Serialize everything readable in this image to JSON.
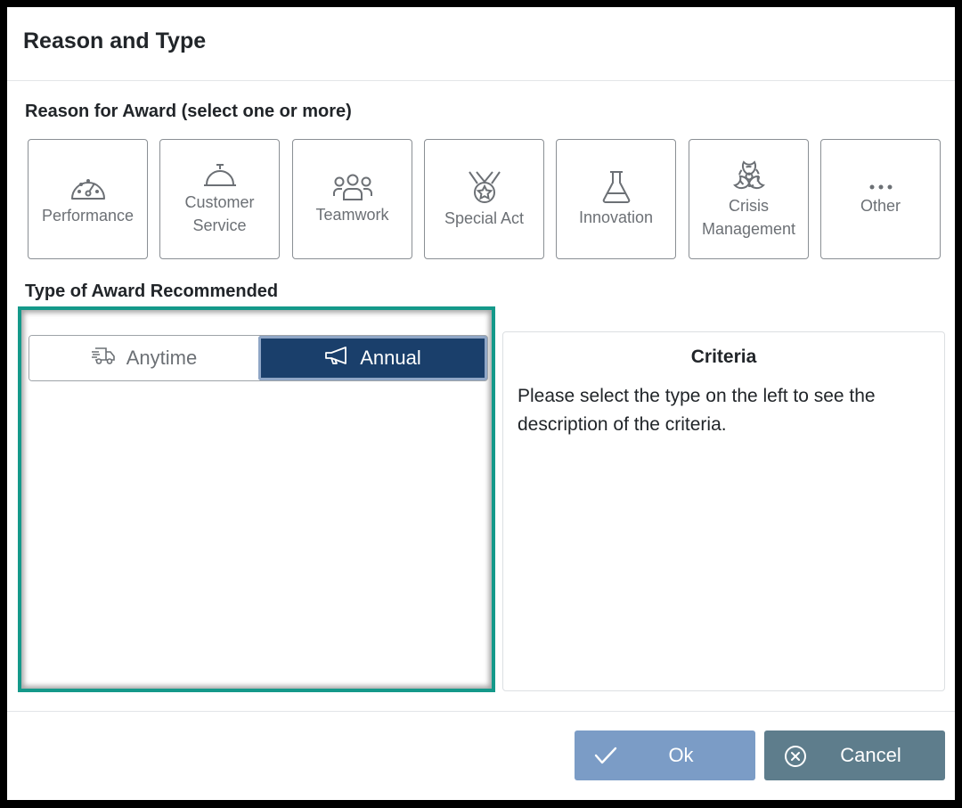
{
  "dialog": {
    "title": "Reason and Type"
  },
  "reason_section": {
    "label": "Reason for Award (select one or more)",
    "tiles": [
      {
        "icon": "speedometer-icon",
        "line1": "Performance",
        "line2": ""
      },
      {
        "icon": "service-bell-icon",
        "line1": "Customer",
        "line2": "Service"
      },
      {
        "icon": "people-group-icon",
        "line1": "Teamwork",
        "line2": ""
      },
      {
        "icon": "medal-icon",
        "line1": "Special Act",
        "line2": ""
      },
      {
        "icon": "flask-icon",
        "line1": "Innovation",
        "line2": ""
      },
      {
        "icon": "biohazard-icon",
        "line1": "Crisis",
        "line2": "Management"
      },
      {
        "icon": "ellipsis-icon",
        "line1": "Other",
        "line2": ""
      }
    ]
  },
  "type_section": {
    "label": "Type of Award Recommended",
    "options": [
      {
        "label": "Anytime",
        "icon": "delivery-truck-icon",
        "selected": false
      },
      {
        "label": "Annual",
        "icon": "megaphone-icon",
        "selected": true
      }
    ],
    "active_color": "#1a3f6b",
    "highlight_color": "#14998a"
  },
  "criteria": {
    "title": "Criteria",
    "text": "Please select the type on the left to see the description of the criteria."
  },
  "footer": {
    "ok_label": "Ok",
    "cancel_label": "Cancel"
  }
}
